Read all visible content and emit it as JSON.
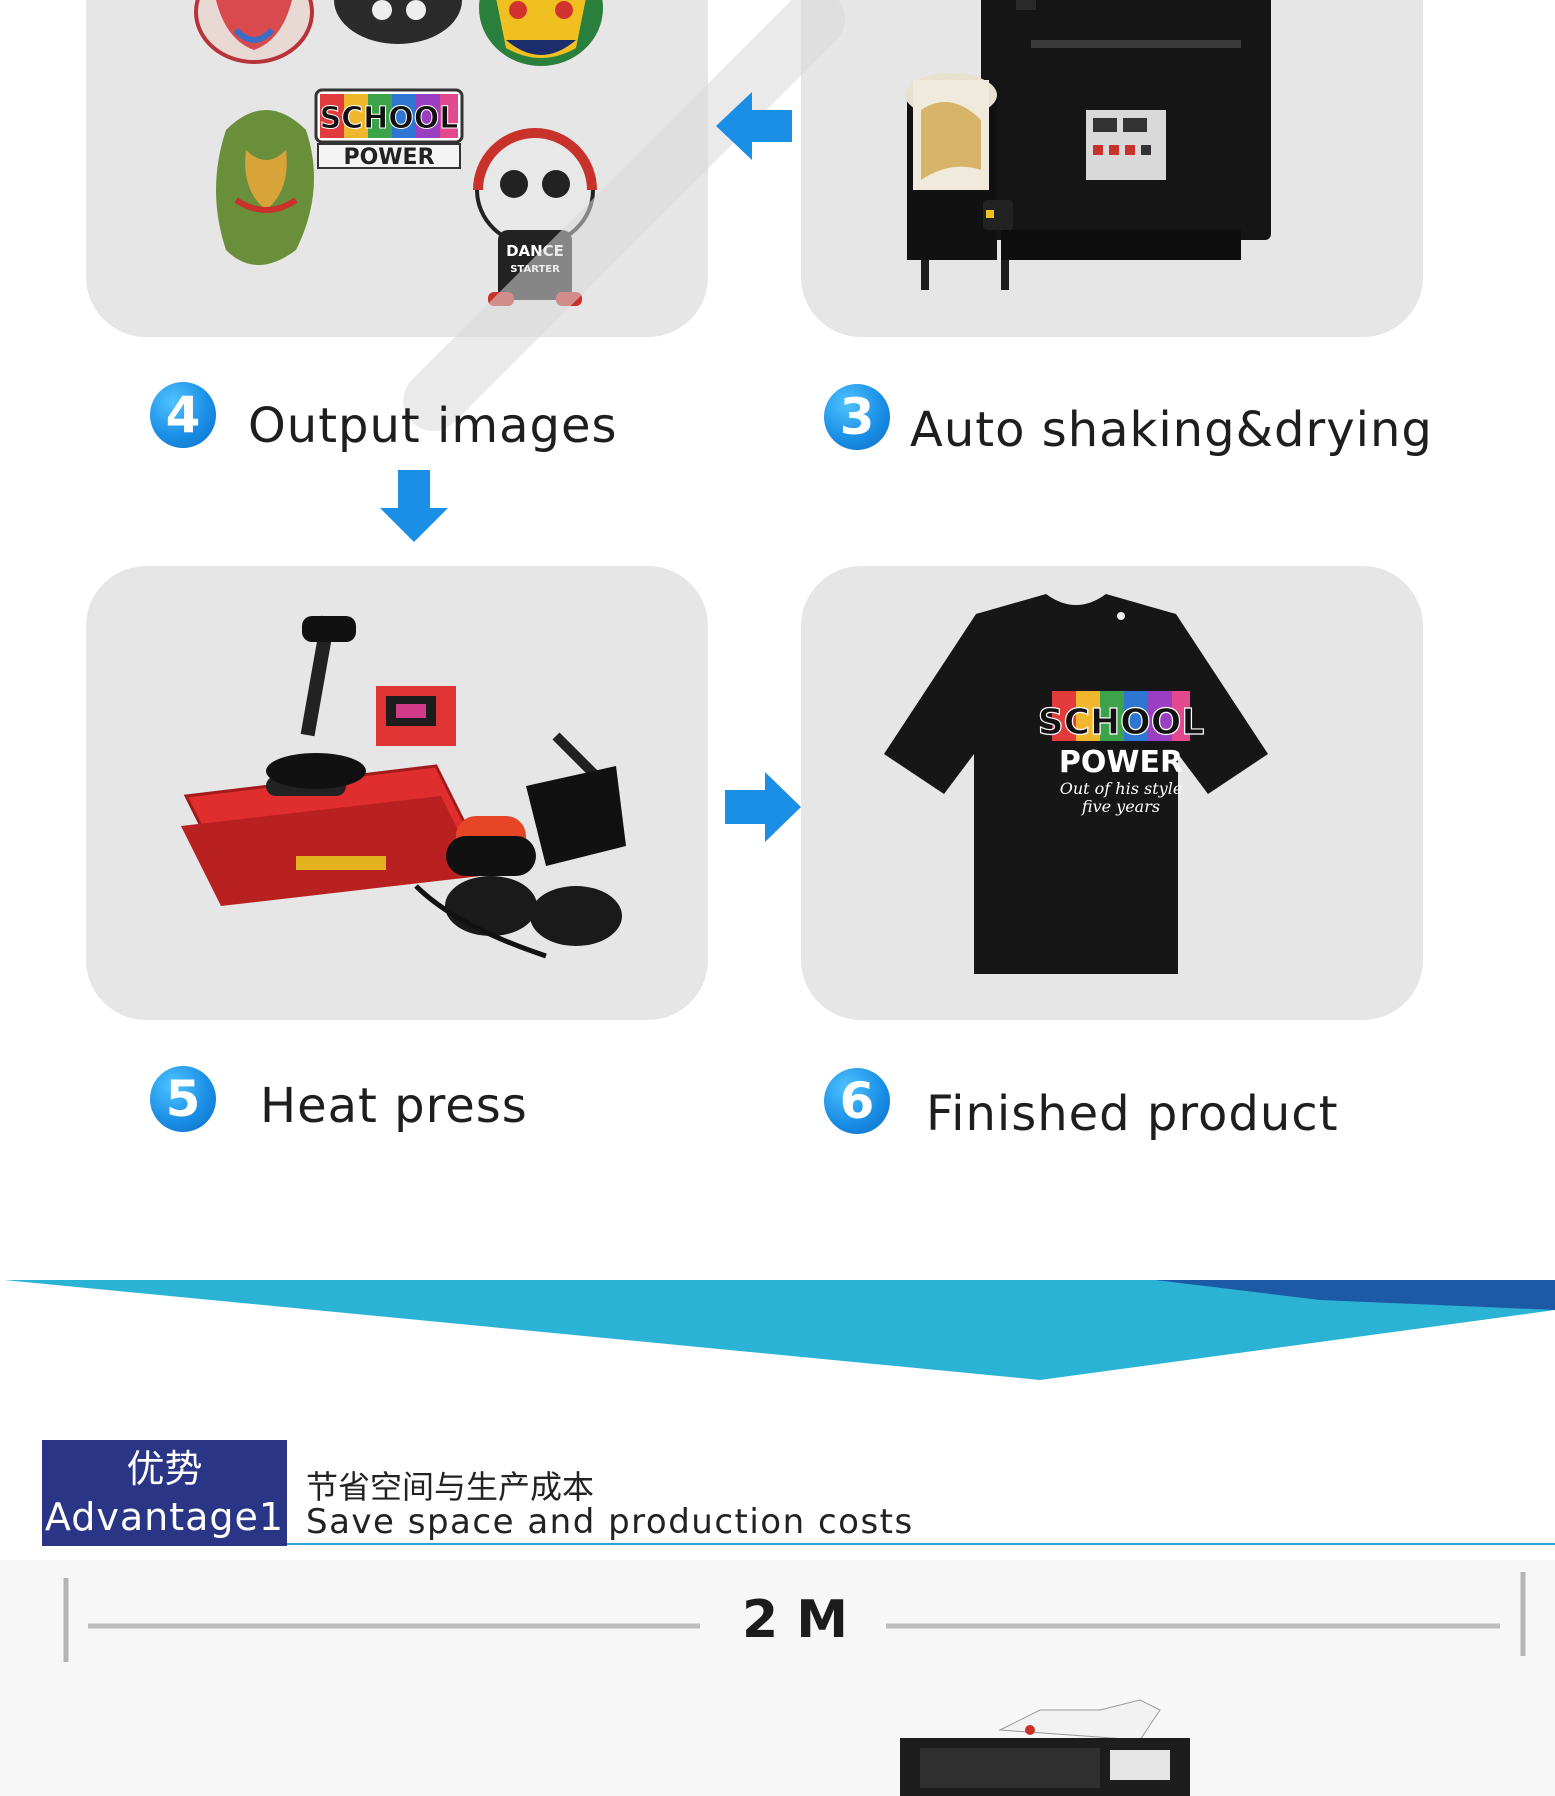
{
  "steps": [
    {
      "num": "4",
      "label": "Output images"
    },
    {
      "num": "3",
      "label": "Auto shaking&drying"
    },
    {
      "num": "5",
      "label": "Heat press"
    },
    {
      "num": "6",
      "label": "Finished product"
    }
  ],
  "artwork": {
    "sticker_school": "SCHOOL",
    "sticker_power": "POWER",
    "sticker_dance": "DANCE",
    "sticker_starter": "STARTER",
    "shirt_school": "SCHOOL",
    "shirt_power": "POWER",
    "shirt_tagline_1": "Out of his style",
    "shirt_tagline_2": "five years"
  },
  "advantage": {
    "badge_cn": "优势",
    "badge_en": "Advantage1",
    "title_cn": "节省空间与生产成本",
    "title_en": "Save space and production costs"
  },
  "measure": {
    "label": "2 M"
  },
  "colors": {
    "accent_blue": "#1b8fe6",
    "banner_cyan": "#2bb3d6",
    "banner_navy": "#1d5aa6",
    "badge_navy": "#2a3585",
    "panel_gray": "#e6e6e6"
  },
  "icons": [
    "arrow-left-icon",
    "arrow-down-icon",
    "arrow-right-icon"
  ]
}
